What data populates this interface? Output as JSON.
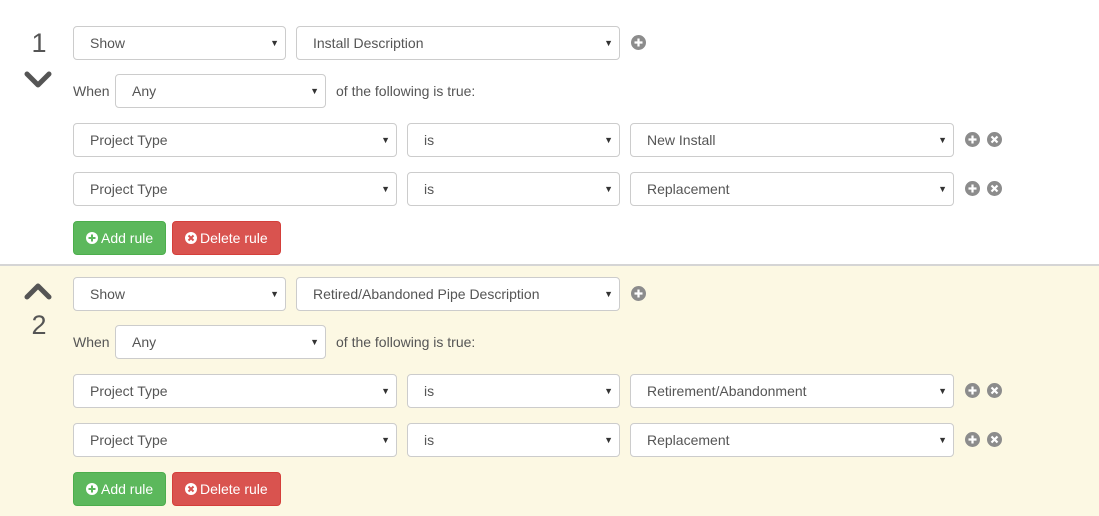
{
  "groups": [
    {
      "number": "1",
      "chevron_icon": "chevron-down-icon",
      "action": "Show",
      "target": "Install Description",
      "when_label": "When",
      "match": "Any",
      "match_suffix": "of the following is true:",
      "conditions": [
        {
          "field": "Project Type",
          "operator": "is",
          "value": "New Install"
        },
        {
          "field": "Project Type",
          "operator": "is",
          "value": "Replacement"
        }
      ],
      "add_rule_label": "Add rule",
      "delete_rule_label": "Delete rule"
    },
    {
      "number": "2",
      "chevron_icon": "chevron-up-icon",
      "action": "Show",
      "target": "Retired/Abandoned Pipe Description",
      "when_label": "When",
      "match": "Any",
      "match_suffix": "of the following is true:",
      "conditions": [
        {
          "field": "Project Type",
          "operator": "is",
          "value": "Retirement/Abandonment"
        },
        {
          "field": "Project Type",
          "operator": "is",
          "value": "Replacement"
        }
      ],
      "add_rule_label": "Add rule",
      "delete_rule_label": "Delete rule"
    }
  ],
  "colors": {
    "highlight_background": "#fcf8e3",
    "add_button": "#5cb85c",
    "delete_button": "#d9534f",
    "icon_gray": "#8c8c8c"
  }
}
